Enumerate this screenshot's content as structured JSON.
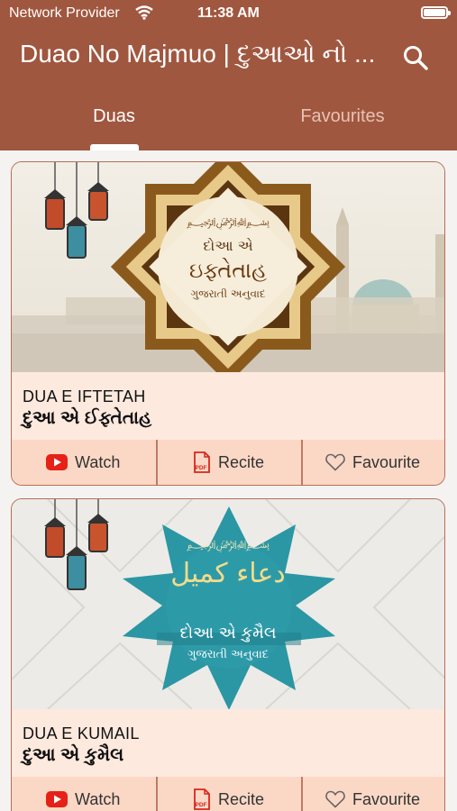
{
  "status_bar": {
    "provider": "Network Provider",
    "time": "11:38 AM"
  },
  "app_bar": {
    "title": "Duao No Majmuo | દુઆઓ નો ..."
  },
  "tabs": [
    {
      "label": "Duas"
    },
    {
      "label": "Favourites"
    }
  ],
  "cards": [
    {
      "image_line1": "દોઆ એ",
      "image_line2": "ઇફ્તેતાહ",
      "image_line3": "ગુજરાતી અનુવાદ",
      "title_en": "DUA E IFTETAH",
      "title_gu": "દુઆ એ ઈફ્તેતાહ",
      "actions": {
        "watch": "Watch",
        "recite": "Recite",
        "favourite": "Favourite"
      }
    },
    {
      "image_line1": "દોઆ એ કુમૈલ",
      "image_line2": "ગુજરાતી અનુવાદ",
      "title_en": "DUA E KUMAIL",
      "title_gu": "દુઆ એ કુમૈલ",
      "actions": {
        "watch": "Watch",
        "recite": "Recite",
        "favourite": "Favourite"
      }
    }
  ],
  "colors": {
    "header": "#a0573f",
    "card_bg": "#fde8dd",
    "actions_bg": "#fbd8c6",
    "youtube_red": "#e62117",
    "pdf_red": "#d7261c"
  }
}
